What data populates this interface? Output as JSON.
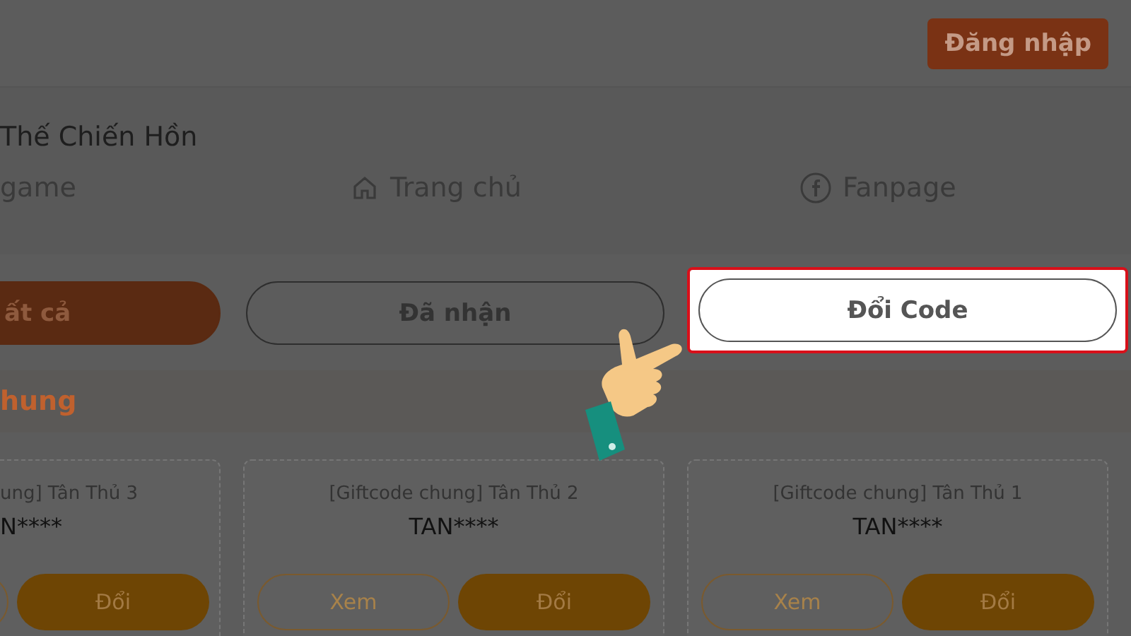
{
  "header": {
    "login_button": "Đăng nhập"
  },
  "site_title": "Thế Chiến Hồn",
  "nav": [
    {
      "kind": "plain",
      "label": "game"
    },
    {
      "kind": "home",
      "label": "Trang chủ"
    },
    {
      "kind": "facebook",
      "label": "Fanpage"
    }
  ],
  "tabs": [
    {
      "label": "ất cả",
      "selected": true,
      "highlighted": false
    },
    {
      "label": "Đã nhận",
      "selected": false,
      "highlighted": false
    },
    {
      "label": "Đổi Code",
      "selected": false,
      "highlighted": true
    }
  ],
  "section_title": "hung",
  "cards": [
    {
      "title": "ung] Tân Thủ 3",
      "code": "N****",
      "redeem_button": "Đổi"
    },
    {
      "title": "[Giftcode chung] Tân Thủ 2",
      "code": "TAN****",
      "view_button": "Xem",
      "redeem_button": "Đổi"
    },
    {
      "title": "[Giftcode chung] Tân Thủ 1",
      "code": "TAN****",
      "view_button": "Xem",
      "redeem_button": "Đổi"
    }
  ]
}
